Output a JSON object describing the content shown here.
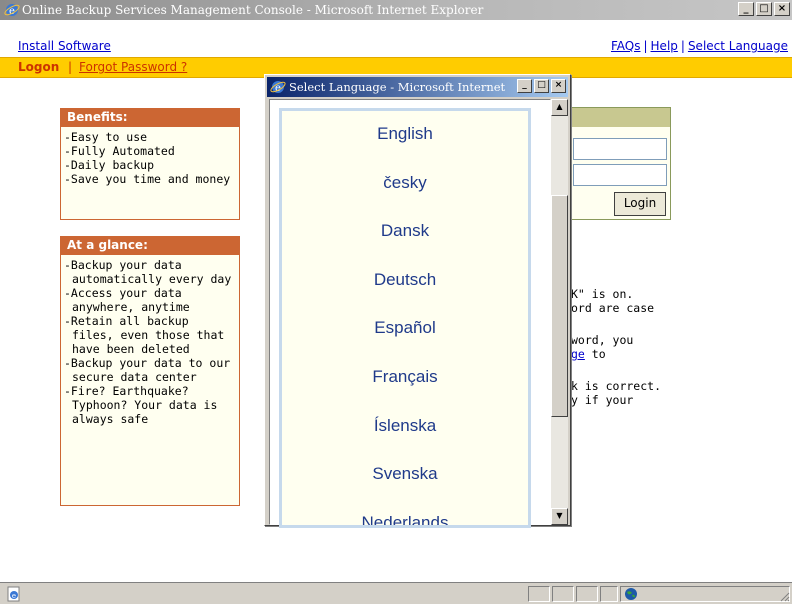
{
  "window": {
    "title": "Online Backup Services Management Console - Microsoft Internet Explorer",
    "minimize_glyph": "_",
    "maximize_glyph": "□",
    "close_glyph": "×"
  },
  "topbar": {
    "install_link": "Install Software",
    "faqs_link": "FAQs",
    "help_link": "Help",
    "select_language_link": "Select Language",
    "separator": "|"
  },
  "nav": {
    "logon": "Logon",
    "separator": "|",
    "forgot_password": "Forgot Password ?"
  },
  "benefits": {
    "heading": "Benefits:",
    "items": [
      "-Easy to use",
      "-Fully Automated",
      "-Daily backup",
      "-Save you time and money"
    ]
  },
  "glance": {
    "heading": "At a glance:",
    "items": [
      "-Backup your data automatically every day",
      "-Access your data anywhere, anytime",
      "-Retain all backup files, even those that have been deleted",
      "-Backup your data to our secure data center",
      "-Fire? Earthquake? Typhoon? Your data is always safe"
    ]
  },
  "login": {
    "button": "Login"
  },
  "hints": {
    "line1": "K\" is on.",
    "line2": "ord are case",
    "line3": "word, you",
    "line4_link": "ge",
    "line4_rest": " to",
    "line5": "k is correct.",
    "line6": "y if your"
  },
  "popup": {
    "title": "Select Language - Microsoft Internet",
    "languages": [
      "English",
      "česky",
      "Dansk",
      "Deutsch",
      "Español",
      "Français",
      "Íslenska",
      "Svenska",
      "Nederlands"
    ]
  },
  "colors": {
    "yellow_bar": "#ffcc00",
    "box_header": "#cc6633",
    "language_text": "#1f3a8a",
    "link": "#0000cc"
  },
  "icons": [
    "ie-icon",
    "earth-zone-icon",
    "resize-grip-icon"
  ]
}
